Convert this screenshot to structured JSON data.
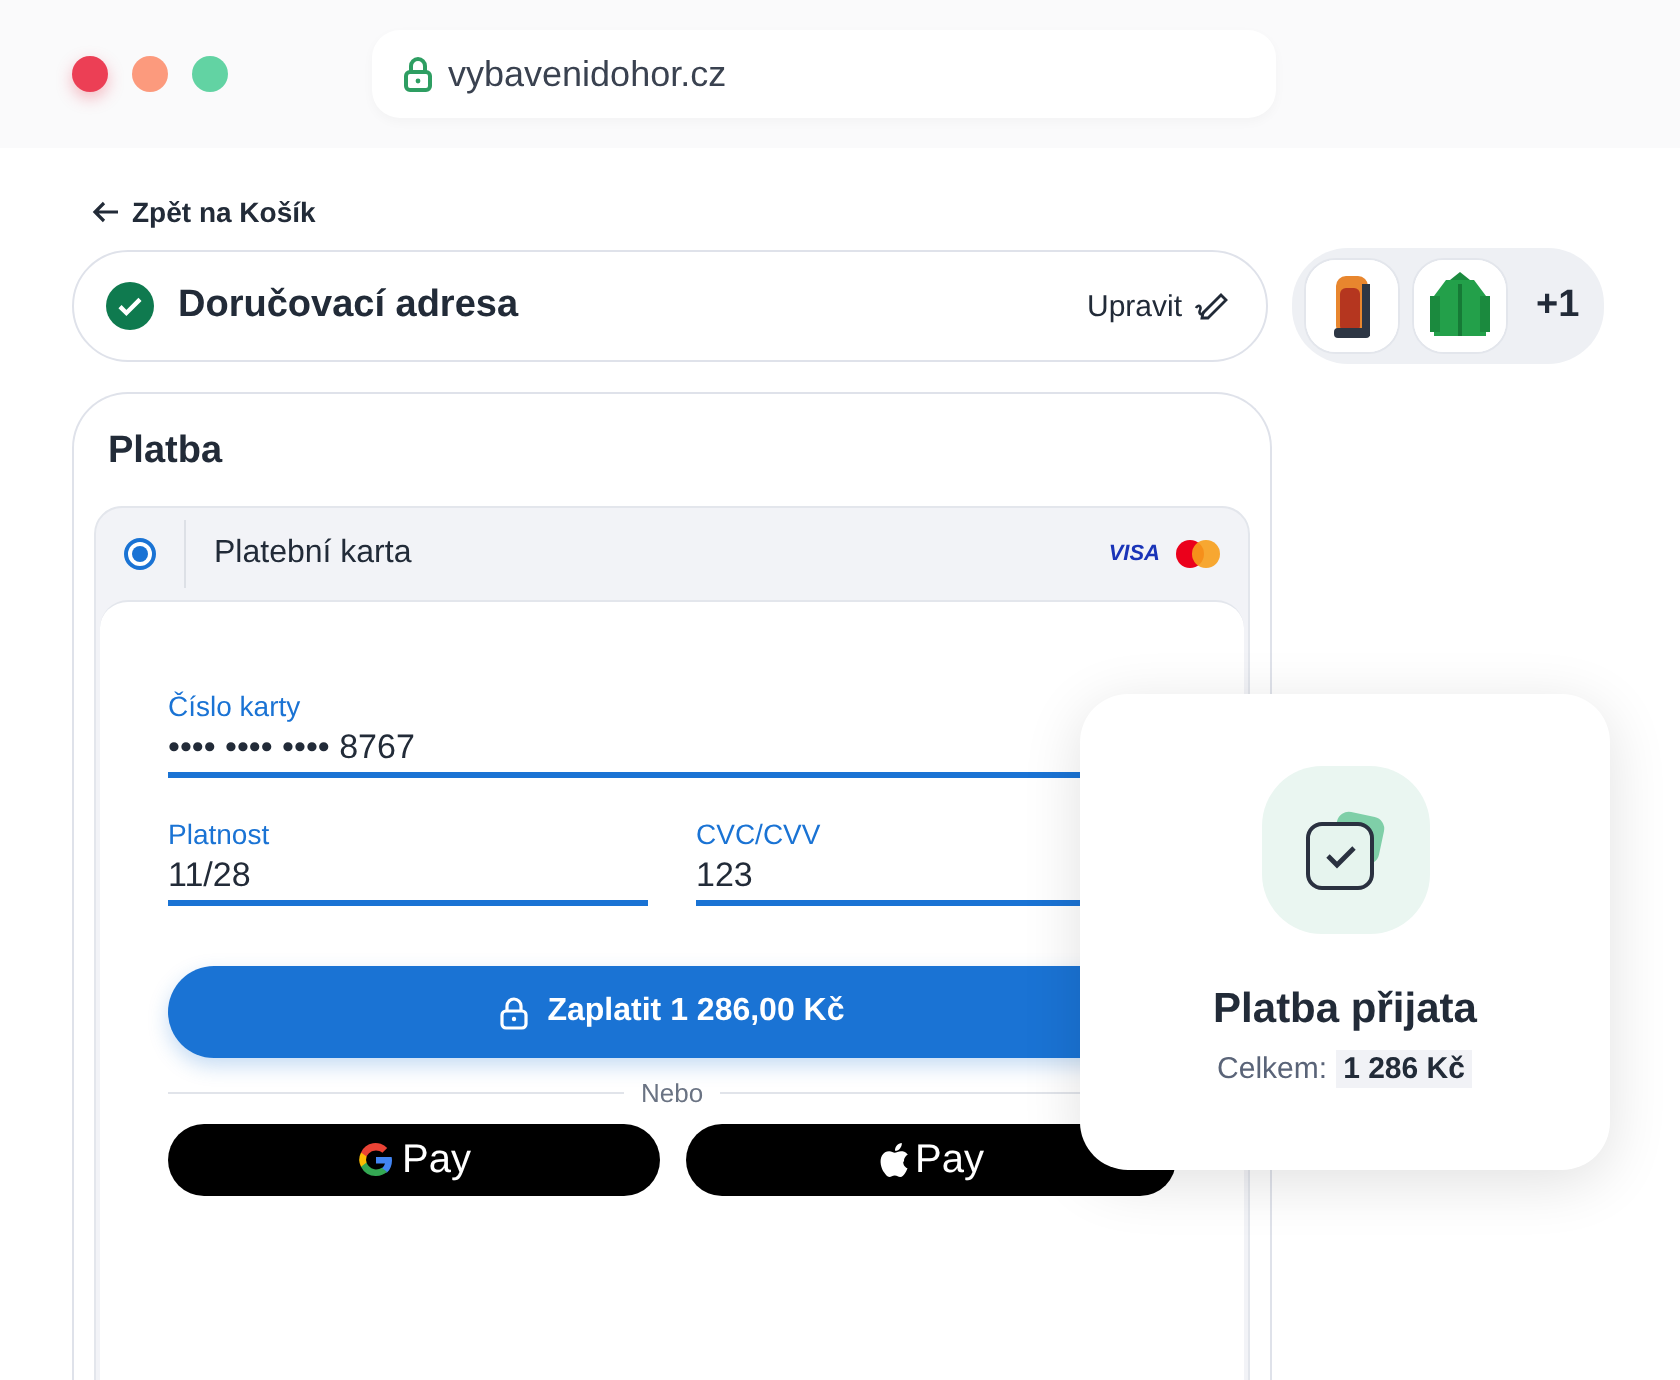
{
  "browser": {
    "url": "vybavenidohor.cz"
  },
  "back_link": "Zpět na Košík",
  "delivery": {
    "title": "Doručovací adresa",
    "completed": true,
    "edit_label": "Upravit"
  },
  "cart_preview": {
    "more": "+1"
  },
  "payment": {
    "title": "Platba",
    "methods": [
      {
        "label": "Platební karta",
        "selected": true,
        "brand": "VISA"
      }
    ],
    "fields": [
      {
        "label": "Číslo karty",
        "value": "•••• •••• •••• 8767"
      },
      {
        "label": "Platnost",
        "value": "11/28"
      },
      {
        "label": "CVC/CVV",
        "value": "123"
      }
    ],
    "pay_button": "Zaplatit 1 286,00 Kč",
    "divider": "Nebo",
    "wallets": [
      {
        "kind": "google",
        "label": "Pay"
      },
      {
        "kind": "apple",
        "label": "Pay"
      }
    ]
  },
  "toast": {
    "title": "Platba přijata",
    "total_label": "Celkem:",
    "total_value": "1 286 Kč"
  }
}
